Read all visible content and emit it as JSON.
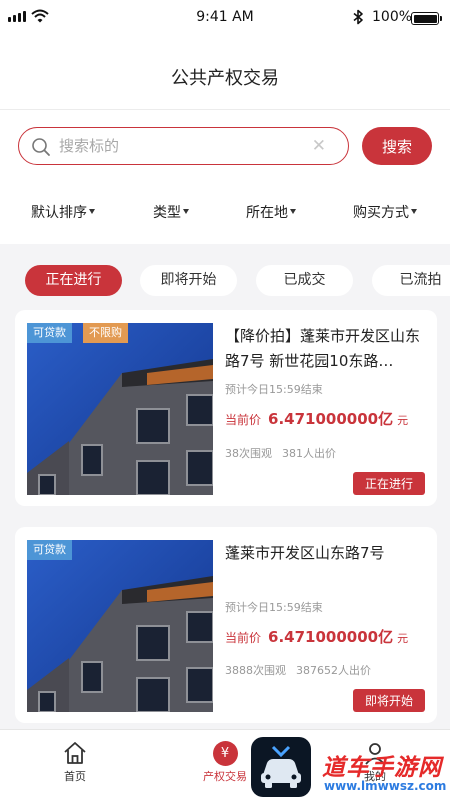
{
  "status_bar": {
    "time": "9:41 AM",
    "battery": "100%"
  },
  "header": {
    "title": "公共产权交易"
  },
  "search": {
    "placeholder": "搜索标的",
    "button": "搜索"
  },
  "filters": [
    "默认排序",
    "类型",
    "所在地",
    "购买方式"
  ],
  "tabs": [
    {
      "label": "正在进行",
      "active": true
    },
    {
      "label": "即将开始",
      "active": false
    },
    {
      "label": "已成交",
      "active": false
    },
    {
      "label": "已流拍",
      "active": false
    }
  ],
  "listings": [
    {
      "tags": [
        "可贷款",
        "不限购"
      ],
      "title": "【降价拍】蓬莱市开发区山东路7号 新世花园10东路…",
      "ends": "预计今日15:59结束",
      "price_label": "当前价",
      "price": "6.471000000亿",
      "price_unit": "元",
      "views": "38次围观",
      "bids": "381人出价",
      "status": "正在进行"
    },
    {
      "tags": [
        "可贷款"
      ],
      "title": "蓬莱市开发区山东路7号",
      "ends": "预计今日15:59结束",
      "price_label": "当前价",
      "price": "6.471000000亿",
      "price_unit": "元",
      "views": "3888次围观",
      "bids": "387652人出价",
      "status": "即将开始"
    }
  ],
  "tabbar": {
    "home": "首页",
    "trade": "产权交易",
    "trade_badge": "¥",
    "mine": "我的"
  },
  "watermark": {
    "text": "道车手游网",
    "url": "www.lmwwsz.com"
  },
  "colors": {
    "accent": "#c9343b",
    "tag_blue": "#4d95d6",
    "tag_orange": "#e29a52"
  }
}
